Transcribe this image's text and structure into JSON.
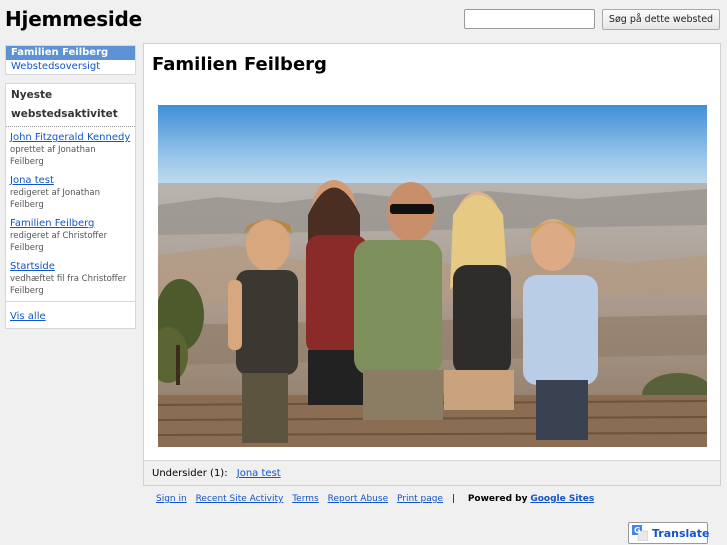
{
  "header": {
    "site_title": "Hjemmeside",
    "search_value": "",
    "search_button": "Søg på dette websted"
  },
  "nav": {
    "items": [
      {
        "label": "Familien Feilberg",
        "selected": true
      },
      {
        "label": "Webstedsoversigt",
        "selected": false
      }
    ]
  },
  "activity": {
    "heading": "Nyeste webstedsaktivitet",
    "items": [
      {
        "title": "John Fitzgerald Kennedy",
        "meta": "oprettet af Jonathan Feilberg"
      },
      {
        "title": "Jona test",
        "meta": "redigeret af Jonathan Feilberg"
      },
      {
        "title": "Familien Feilberg",
        "meta": "redigeret af Christoffer Feilberg"
      },
      {
        "title": "Startside",
        "meta": "vedhæftet fil fra Christoffer Feilberg"
      }
    ],
    "view_all": "Vis alle"
  },
  "main": {
    "page_title": "Familien Feilberg",
    "subpages_label": "Undersider (1):",
    "subpages": [
      "Jona test"
    ]
  },
  "footer": {
    "links": [
      "Sign in",
      "Recent Site Activity",
      "Terms",
      "Report Abuse",
      "Print page"
    ],
    "separator": "|",
    "powered_by": "Powered by",
    "google_sites": "Google Sites",
    "translate": "Translate"
  },
  "colors": {
    "link": "#1155cc",
    "nav_selected_bg": "#5d92d4",
    "page_bg": "#f0f0f0"
  },
  "icons": {
    "translate": "google-translate-icon"
  }
}
